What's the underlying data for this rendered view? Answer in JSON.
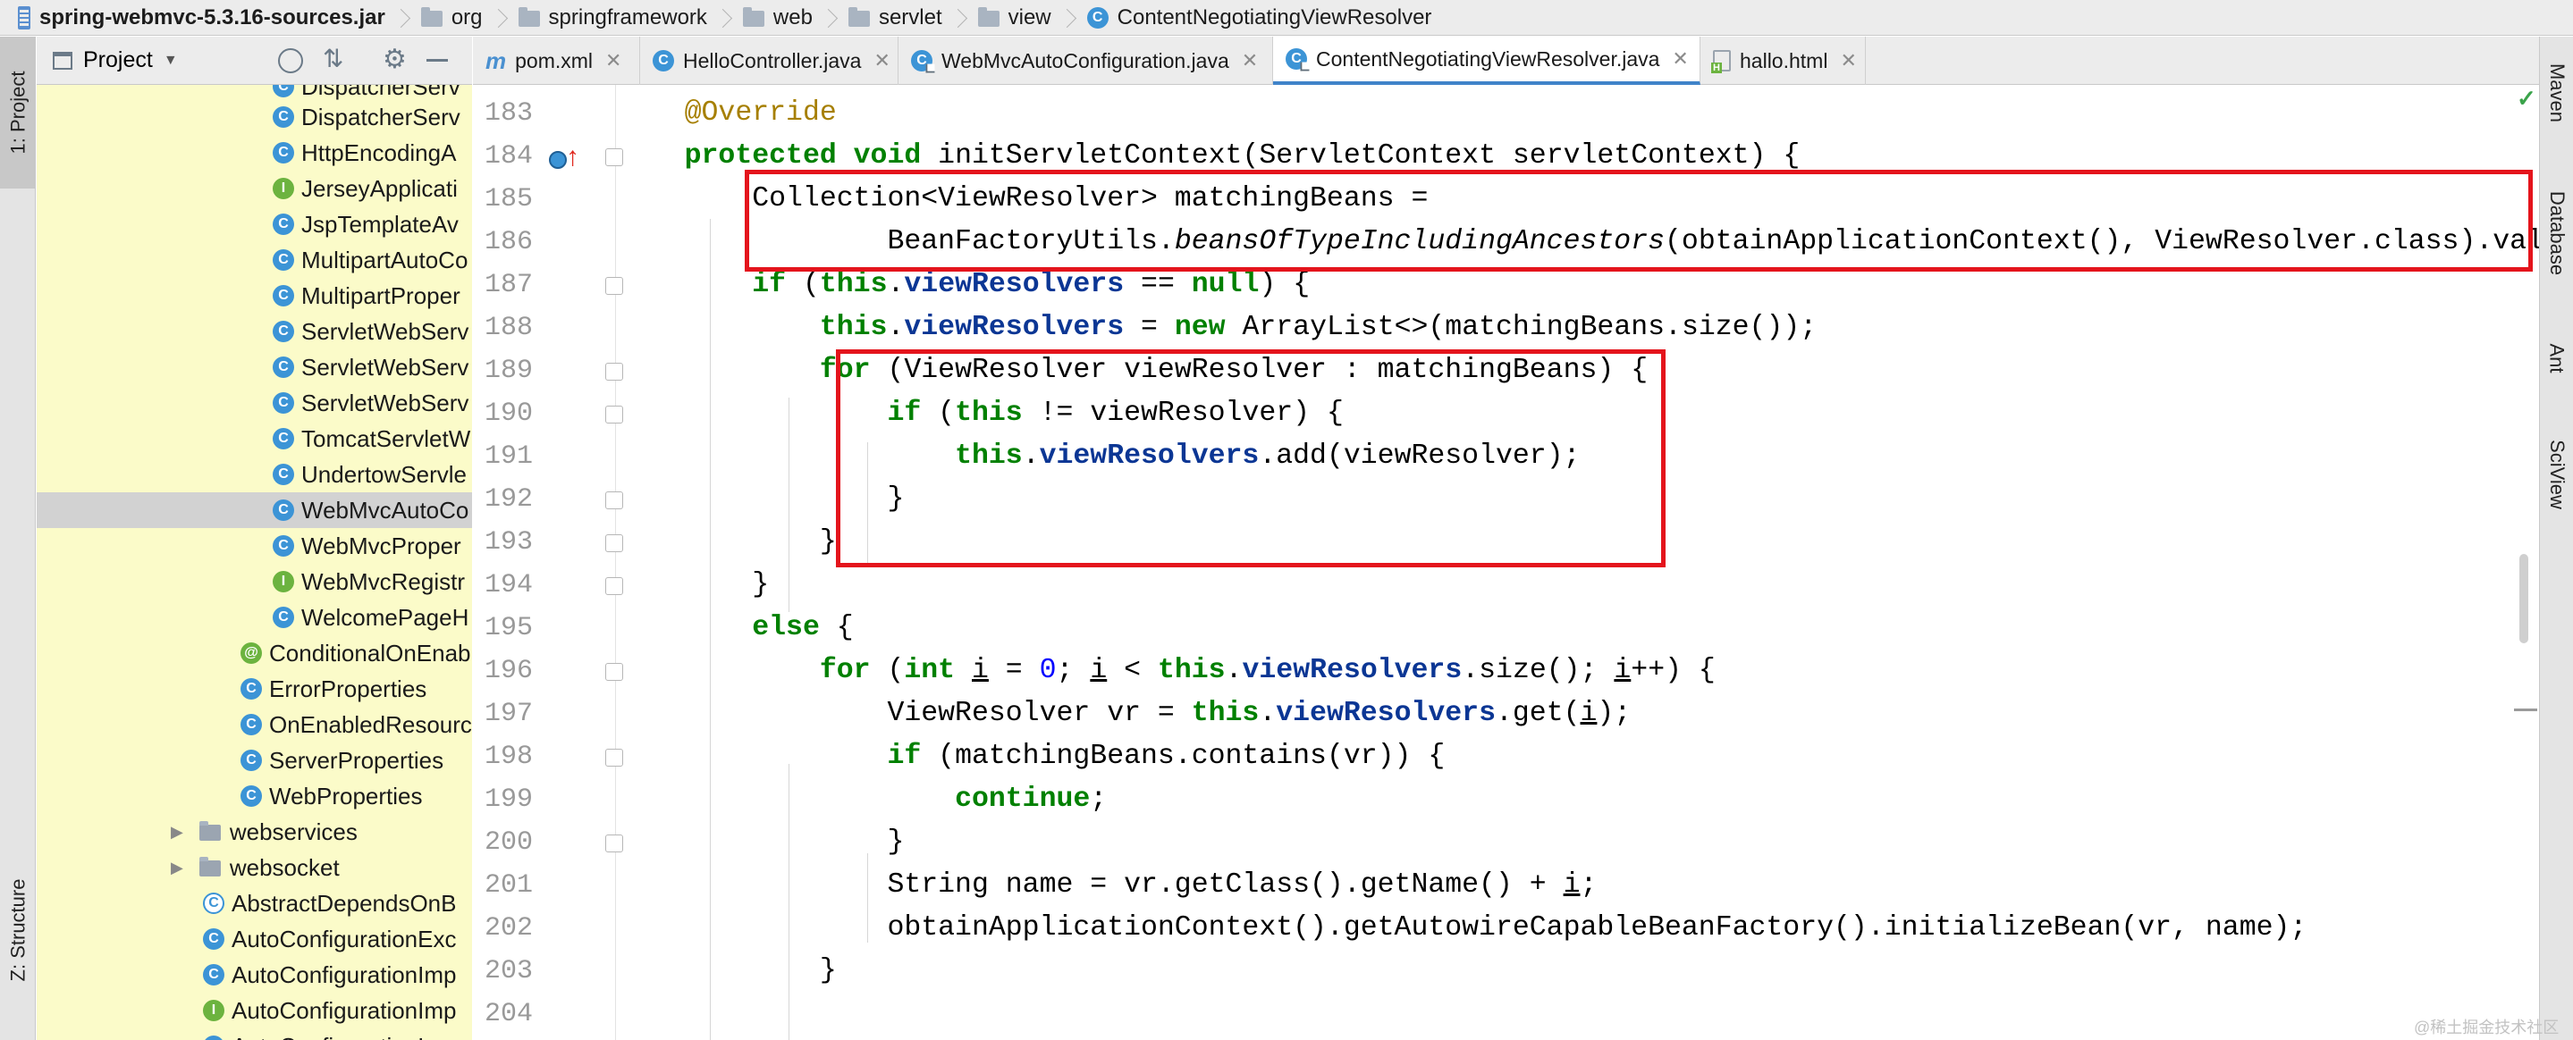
{
  "breadcrumb": [
    "spring-webmvc-5.3.16-sources.jar",
    "org",
    "springframework",
    "web",
    "servlet",
    "view",
    "ContentNegotiatingViewResolver"
  ],
  "left_stripe": {
    "project_tab": "1: Project",
    "structure_tab": "Z: Structure"
  },
  "project_panel": {
    "title": "Project"
  },
  "tree": [
    {
      "label": "DispatcherServ",
      "icon": "class"
    },
    {
      "label": "DispatcherServ",
      "icon": "class"
    },
    {
      "label": "HttpEncodingA",
      "icon": "class"
    },
    {
      "label": "JerseyApplicati",
      "icon": "interface"
    },
    {
      "label": "JspTemplateAv",
      "icon": "class"
    },
    {
      "label": "MultipartAutoCo",
      "icon": "class"
    },
    {
      "label": "MultipartProper",
      "icon": "class"
    },
    {
      "label": "ServletWebServ",
      "icon": "class"
    },
    {
      "label": "ServletWebServ",
      "icon": "class"
    },
    {
      "label": "ServletWebServ",
      "icon": "class"
    },
    {
      "label": "TomcatServletW",
      "icon": "class"
    },
    {
      "label": "UndertowServle",
      "icon": "class"
    },
    {
      "label": "WebMvcAutoCo",
      "icon": "class"
    },
    {
      "label": "WebMvcProper",
      "icon": "class"
    },
    {
      "label": "WebMvcRegistr",
      "icon": "interface"
    },
    {
      "label": "WelcomePageH",
      "icon": "class"
    },
    {
      "label": "ConditionalOnEnab",
      "icon": "annotation"
    },
    {
      "label": "ErrorProperties",
      "icon": "class"
    },
    {
      "label": "OnEnabledResourc",
      "icon": "class"
    },
    {
      "label": "ServerProperties",
      "icon": "class"
    },
    {
      "label": "WebProperties",
      "icon": "class"
    },
    {
      "label": "webservices",
      "icon": "folder"
    },
    {
      "label": "websocket",
      "icon": "folder"
    },
    {
      "label": "AbstractDependsOnB",
      "icon": "class"
    },
    {
      "label": "AutoConfigurationExc",
      "icon": "class"
    },
    {
      "label": "AutoConfigurationImp",
      "icon": "class"
    },
    {
      "label": "AutoConfigurationImp",
      "icon": "interface"
    },
    {
      "label": "AutoConfigurationI",
      "icon": "class"
    }
  ],
  "tabs": [
    {
      "label": "pom.xml",
      "icon": "maven"
    },
    {
      "label": "HelloController.java",
      "icon": "class"
    },
    {
      "label": "WebMvcAutoConfiguration.java",
      "icon": "class"
    },
    {
      "label": "ContentNegotiatingViewResolver.java",
      "icon": "class",
      "active": true
    },
    {
      "label": "hallo.html",
      "icon": "html"
    }
  ],
  "editor": {
    "line_numbers": [
      "183",
      "184",
      "185",
      "186",
      "187",
      "188",
      "189",
      "190",
      "191",
      "192",
      "193",
      "194",
      "195",
      "196",
      "197",
      "198",
      "199",
      "200",
      "201",
      "202",
      "203",
      "204"
    ]
  },
  "right_stripe": {
    "maven": "Maven",
    "database": "Database",
    "ant": "Ant",
    "sciview": "SciView"
  },
  "watermark": "@稀土掘金技术社区"
}
